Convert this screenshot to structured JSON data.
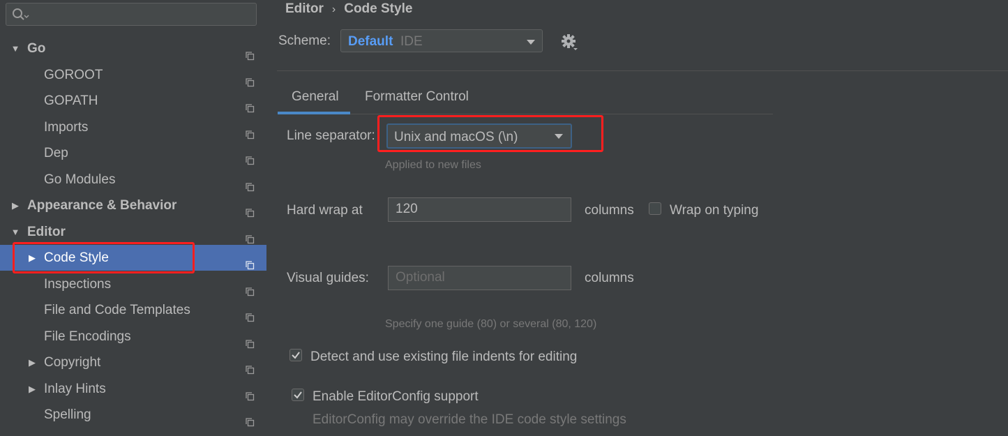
{
  "search": {
    "placeholder": ""
  },
  "sidebar": {
    "items": [
      {
        "label": "Go",
        "level": 0,
        "expanded": true,
        "has_children": true,
        "bold": true,
        "selected": false
      },
      {
        "label": "GOROOT",
        "level": 1,
        "has_children": false,
        "selected": false
      },
      {
        "label": "GOPATH",
        "level": 1,
        "has_children": false,
        "selected": false
      },
      {
        "label": "Imports",
        "level": 1,
        "has_children": false,
        "selected": false
      },
      {
        "label": "Dep",
        "level": 1,
        "has_children": false,
        "selected": false
      },
      {
        "label": "Go Modules",
        "level": 1,
        "has_children": false,
        "selected": false
      },
      {
        "label": "Appearance & Behavior",
        "level": 0,
        "expanded": false,
        "has_children": true,
        "bold": true,
        "selected": false
      },
      {
        "label": "Editor",
        "level": 0,
        "expanded": true,
        "has_children": true,
        "bold": true,
        "selected": false
      },
      {
        "label": "Code Style",
        "level": 1,
        "expanded": false,
        "has_children": true,
        "selected": true
      },
      {
        "label": "Inspections",
        "level": 1,
        "has_children": false,
        "selected": false
      },
      {
        "label": "File and Code Templates",
        "level": 1,
        "has_children": false,
        "selected": false
      },
      {
        "label": "File Encodings",
        "level": 1,
        "has_children": false,
        "selected": false
      },
      {
        "label": "Copyright",
        "level": 1,
        "expanded": false,
        "has_children": true,
        "selected": false
      },
      {
        "label": "Inlay Hints",
        "level": 1,
        "expanded": false,
        "has_children": true,
        "selected": false
      },
      {
        "label": "Spelling",
        "level": 1,
        "has_children": false,
        "selected": false
      }
    ]
  },
  "breadcrumb": {
    "parent": "Editor",
    "current": "Code Style",
    "separator": "›"
  },
  "scheme": {
    "label": "Scheme:",
    "name": "Default",
    "type": "IDE"
  },
  "tabs": [
    {
      "label": "General",
      "active": true
    },
    {
      "label": "Formatter Control",
      "active": false
    }
  ],
  "general": {
    "line_separator_label": "Line separator:",
    "line_separator_value": "Unix and macOS (\\n)",
    "line_separator_hint": "Applied to new files",
    "hard_wrap_label": "Hard wrap at",
    "hard_wrap_value": "120",
    "hard_wrap_unit": "columns",
    "wrap_on_typing_label": "Wrap on typing",
    "wrap_on_typing_checked": false,
    "visual_guides_label": "Visual guides:",
    "visual_guides_placeholder": "Optional",
    "visual_guides_unit": "columns",
    "visual_guides_hint": "Specify one guide (80) or several (80, 120)",
    "detect_indents_label": "Detect and use existing file indents for editing",
    "detect_indents_checked": true,
    "editorconfig_label": "Enable EditorConfig support",
    "editorconfig_checked": true,
    "editorconfig_hint": "EditorConfig may override the IDE code style settings"
  },
  "colors": {
    "background": "#3c3f41",
    "selection": "#4b6eaf",
    "accent_blue": "#589df6",
    "highlight_red": "#ff1f1f"
  },
  "icons": {
    "search": "search-icon",
    "copy": "copy-icon",
    "gear": "gear-icon",
    "dropdown": "chevron-down-icon",
    "check": "check-icon"
  }
}
